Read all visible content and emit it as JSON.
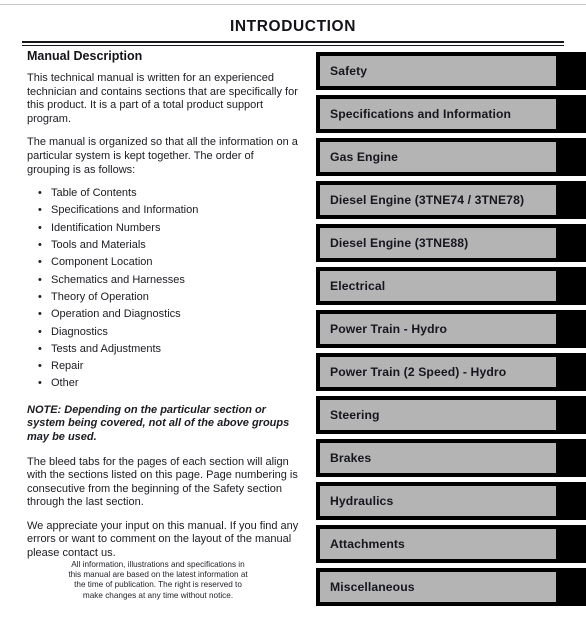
{
  "document": {
    "title": "INTRODUCTION"
  },
  "left_column": {
    "heading": "Manual Description",
    "paragraph_1": "This technical manual is written for an experienced technician and contains sections that are specifically for this product. It is a part of a total product support program.",
    "paragraph_2": "The manual is organized so that all the information on a particular system is kept together. The order of grouping is as follows:",
    "group_list": [
      "Table of Contents",
      "Specifications and Information",
      "Identification Numbers",
      "Tools and Materials",
      "Component Location",
      "Schematics and Harnesses",
      "Theory of Operation",
      "Operation and Diagnostics",
      "Diagnostics",
      "Tests and Adjustments",
      "Repair",
      "Other"
    ],
    "bullet_glyph": "•",
    "note": "NOTE: Depending on the particular section or system being covered, not all of the above groups may be used.",
    "paragraph_3": "The bleed tabs for the pages of each section will align with the sections listed on this page. Page numbering is consecutive from the beginning of the Safety section through the last section.",
    "paragraph_4": "We appreciate your input on this manual. If you find any errors or want to comment on the layout of the manual please contact us.",
    "footer_note": "All information, illustrations and specifications in this manual are based on the latest information at the time of publication. The right is reserved to make changes at any time without notice."
  },
  "section_tabs": [
    {
      "label": "Safety"
    },
    {
      "label": "Specifications and Information"
    },
    {
      "label": "Gas Engine"
    },
    {
      "label": "Diesel Engine (3TNE74 / 3TNE78)"
    },
    {
      "label": "Diesel Engine (3TNE88)"
    },
    {
      "label": "Electrical"
    },
    {
      "label": "Power Train - Hydro"
    },
    {
      "label": "Power Train (2 Speed) - Hydro"
    },
    {
      "label": "Steering"
    },
    {
      "label": "Brakes"
    },
    {
      "label": "Hydraulics"
    },
    {
      "label": "Attachments"
    },
    {
      "label": "Miscellaneous"
    }
  ],
  "colors": {
    "tab_frame": "#000000",
    "tab_fill": "#b4b4b4",
    "text": "#16161c",
    "page_background": "#ffffff"
  }
}
